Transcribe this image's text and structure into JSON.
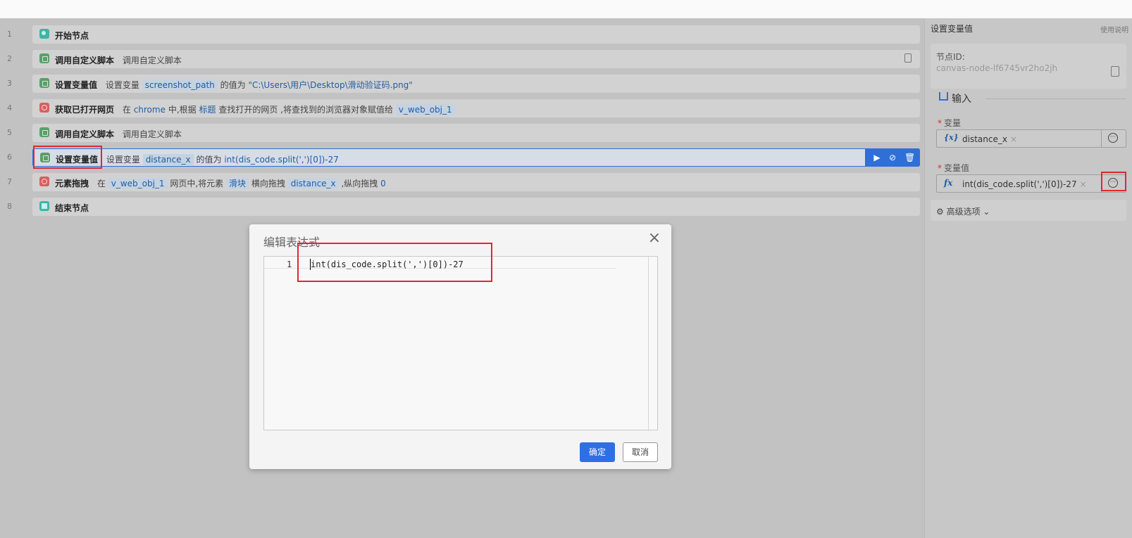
{
  "flow": {
    "rows": [
      {
        "num": "1",
        "title": "开始节点"
      },
      {
        "num": "2",
        "title": "调用自定义脚本",
        "desc": "调用自定义脚本"
      },
      {
        "num": "3",
        "title": "设置变量值",
        "pre": "设置变量",
        "var": "screenshot_path",
        "mid": "的值为",
        "value": "\"C:\\Users\\用户\\Desktop\\滑动验证码.png\""
      },
      {
        "num": "4",
        "title": "获取已打开网页",
        "p1": "在",
        "browser": "chrome",
        "p2": "中,根据",
        "by": "标题",
        "p3": "查找打开的网页 ,将查找到的浏览器对象赋值给",
        "var": "v_web_obj_1"
      },
      {
        "num": "5",
        "title": "调用自定义脚本",
        "desc": "调用自定义脚本"
      },
      {
        "num": "6",
        "title": "设置变量值",
        "pre": "设置变量",
        "var": "distance_x",
        "mid": "的值为",
        "value": "int(dis_code.split(',')[0])-27"
      },
      {
        "num": "7",
        "title": "元素拖拽",
        "p1": "在",
        "obj": "v_web_obj_1",
        "p2": "网页中,将元素",
        "el": "滑块",
        "p3": "横向拖拽",
        "dx": "distance_x",
        "p4": ",纵向拖拽",
        "dy": "0"
      },
      {
        "num": "8",
        "title": "结束节点"
      }
    ]
  },
  "panel": {
    "title": "设置变量值",
    "help": "使用说明",
    "node_id_label": "节点ID:",
    "node_id_value": "canvas-node-lf6745vr2ho2jh",
    "input_section": "输入",
    "var_label": "变量",
    "var_icon": "{x}",
    "var_value": "distance_x",
    "value_label": "变量值",
    "value_icon": "fx",
    "value_value": "int(dis_code.split(',')[0])-27",
    "remove": "×",
    "advanced": "高级选项"
  },
  "modal": {
    "title": "编辑表达式",
    "line_number": "1",
    "code": "int(dis_code.split(',')[0])-27",
    "ok": "确定",
    "cancel": "取消"
  },
  "colors": {
    "accent": "#2f6fd8",
    "highlight": "#e0282e"
  }
}
